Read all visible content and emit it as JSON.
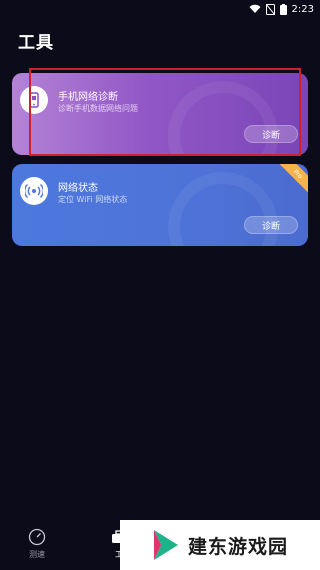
{
  "status_bar": {
    "time": "2:23"
  },
  "page": {
    "title": "工具"
  },
  "cards": [
    {
      "title": "手机网络诊断",
      "subtitle": "诊断手机数据网络问题",
      "button": "诊断",
      "icon": "phone-diagnose-icon",
      "gradient": [
        "#b483d6",
        "#7a45b8"
      ]
    },
    {
      "title": "网络状态",
      "subtitle": "定位 WiFi 网络状态",
      "button": "诊断",
      "badge": "Pro",
      "icon": "wifi-signal-icon",
      "gradient": [
        "#4d78dd",
        "#4b6bd0"
      ]
    }
  ],
  "bottom_nav": [
    {
      "label": "测速",
      "icon": "speedometer-icon"
    },
    {
      "label": "工",
      "icon": "toolbox-icon"
    }
  ],
  "watermark": {
    "text": "建东游戏园"
  },
  "colors": {
    "background": "#0b0b1a",
    "highlight": "#d31f28",
    "badge": "#f5b34a"
  }
}
